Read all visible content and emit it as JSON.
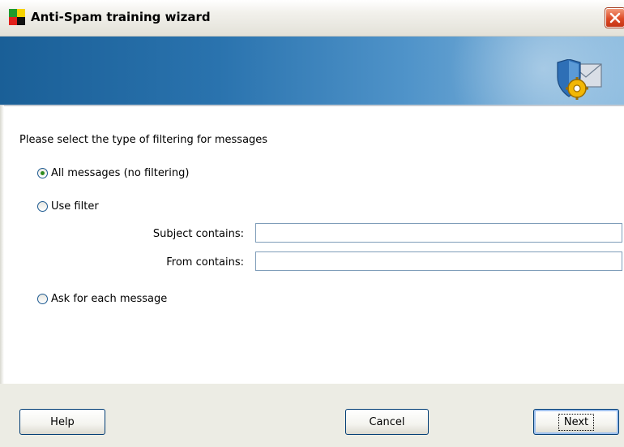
{
  "window": {
    "title": "Anti-Spam training wizard"
  },
  "icons": {
    "app": "app-logo-icon",
    "close": "close-icon",
    "banner": "shield-envelope-gear-icon"
  },
  "colors": {
    "banner_start": "#1a5f97",
    "banner_end": "#8fbde0",
    "footer_bg": "#ecece4",
    "radio_dot": "#2e8b1f",
    "close_button": "#dd4a26"
  },
  "content": {
    "prompt": "Please select the type of filtering for messages",
    "options": [
      {
        "label": "All messages (no filtering)",
        "checked": true
      },
      {
        "label": "Use filter",
        "checked": false
      },
      {
        "label": "Ask for each message",
        "checked": false
      }
    ],
    "filter": {
      "subject_label": "Subject contains:",
      "subject_value": "",
      "from_label": "From contains:",
      "from_value": ""
    }
  },
  "buttons": {
    "help": "Help",
    "cancel": "Cancel",
    "next": "Next"
  }
}
